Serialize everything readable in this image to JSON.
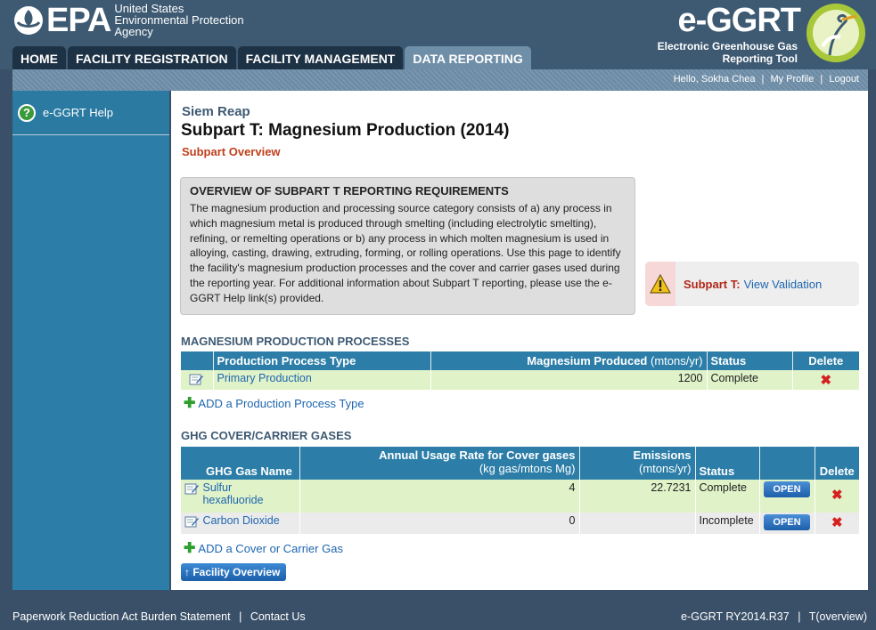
{
  "header": {
    "agency_line1": "United States",
    "agency_line2": "Environmental Protection",
    "agency_line3": "Agency",
    "epa_text": "EPA",
    "product_name": "e-GGRT",
    "product_sub1": "Electronic Greenhouse Gas",
    "product_sub2": "Reporting Tool"
  },
  "tabs": [
    {
      "label": "HOME"
    },
    {
      "label": "FACILITY REGISTRATION"
    },
    {
      "label": "FACILITY MANAGEMENT"
    },
    {
      "label": "DATA REPORTING",
      "active": true
    }
  ],
  "userbar": {
    "greeting": "Hello, Sokha Chea",
    "profile": "My Profile",
    "logout": "Logout"
  },
  "sidebar": {
    "help_label": "e-GGRT Help"
  },
  "main": {
    "facility": "Siem Reap",
    "title": "Subpart T: Magnesium Production (2014)",
    "subtitle": "Subpart Overview",
    "overview_heading": "OVERVIEW OF SUBPART T REPORTING REQUIREMENTS",
    "overview_text": "The magnesium production and processing source category consists of a) any process in which magnesium metal is produced through smelting (including electrolytic smelting), refining, or remelting operations or b) any process in which molten magnesium is used in alloying, casting, drawing, extruding, forming, or rolling operations. Use this page to identify the facility's magnesium production processes and the cover and carrier gases used during the reporting year. For additional information about Subpart T reporting, please use the e-GGRT Help link(s) provided.",
    "validation_label": "Subpart T:",
    "validation_link": "View Validation"
  },
  "processes": {
    "heading": "MAGNESIUM PRODUCTION PROCESSES",
    "col_type": "Production Process Type",
    "col_produced": "Magnesium Produced",
    "col_produced_unit": "(mtons/yr)",
    "col_status": "Status",
    "col_delete": "Delete",
    "rows": [
      {
        "type": "Primary Production",
        "produced": "1200",
        "status": "Complete"
      }
    ],
    "add_label": "ADD a Production Process Type"
  },
  "gases": {
    "heading": "GHG COVER/CARRIER GASES",
    "col_name": "GHG Gas Name",
    "col_rate": "Annual Usage Rate for Cover gases",
    "col_rate_unit": "(kg gas/mtons Mg)",
    "col_emissions": "Emissions",
    "col_emissions_unit": "(mtons/yr)",
    "col_status": "Status",
    "col_delete": "Delete",
    "open_label": "OPEN",
    "rows": [
      {
        "name": "Sulfur hexafluoride",
        "rate": "4",
        "emissions": "22.7231",
        "status": "Complete"
      },
      {
        "name": "Carbon Dioxide",
        "rate": "0",
        "emissions": "",
        "status": "Incomplete"
      }
    ],
    "add_label": "ADD a Cover or Carrier Gas"
  },
  "facility_overview_label": "Facility Overview",
  "footer": {
    "paperwork": "Paperwork Reduction Act Burden Statement",
    "contact": "Contact Us",
    "version": "e-GGRT RY2014.R37",
    "page_code": "T(overview)"
  }
}
